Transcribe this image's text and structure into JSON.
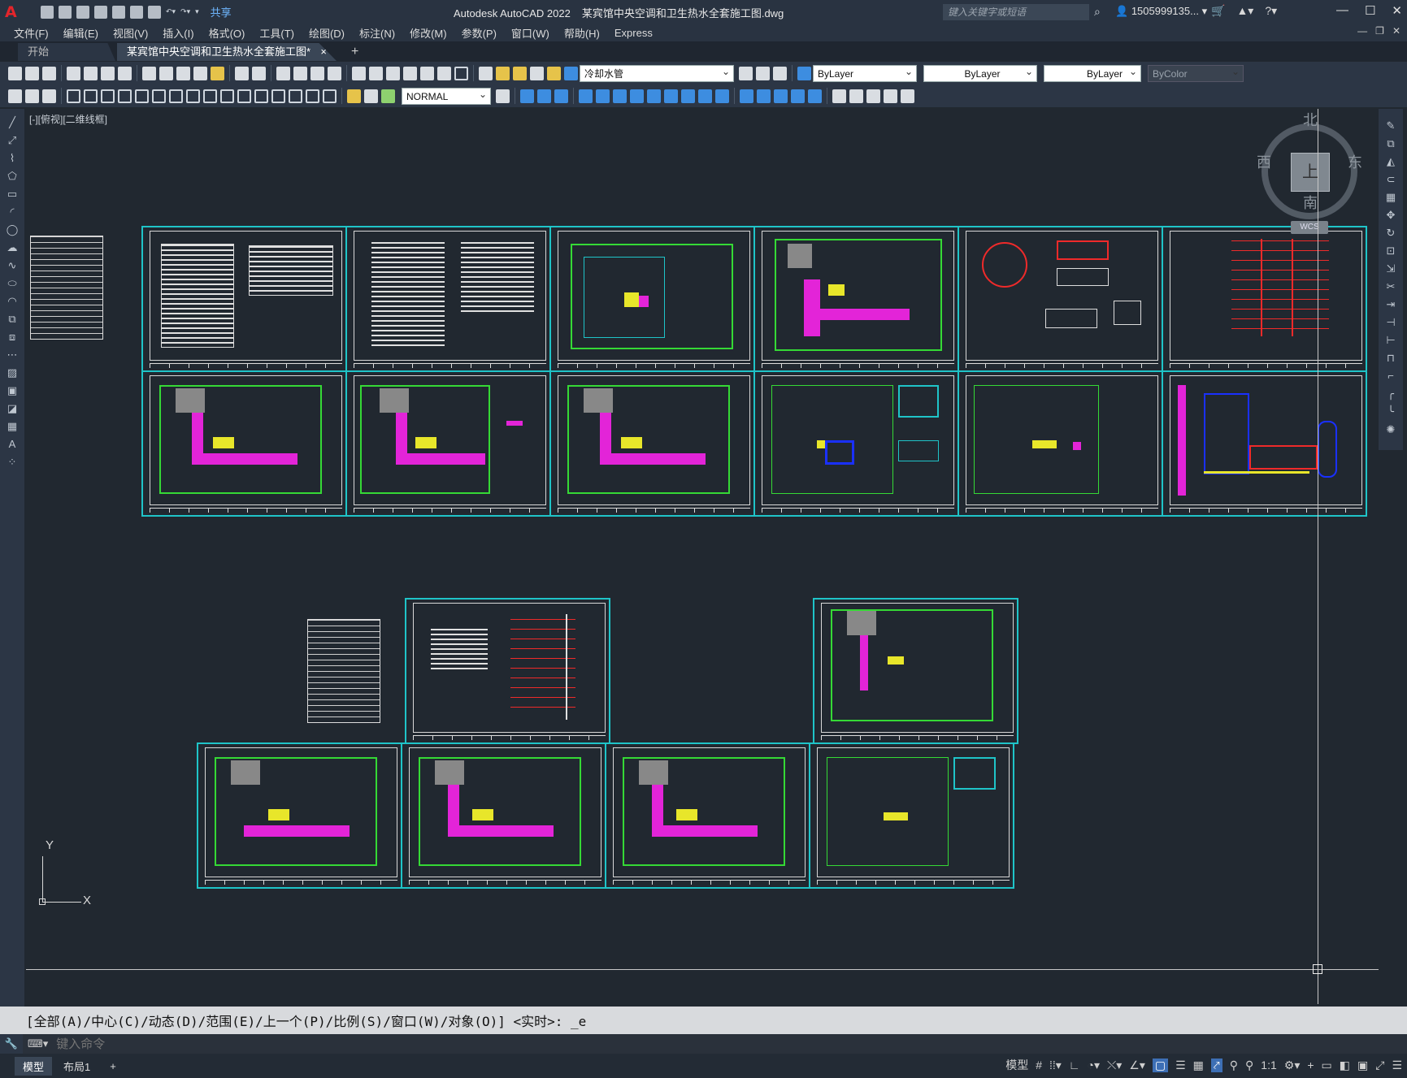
{
  "app": {
    "product": "Autodesk AutoCAD 2022",
    "filename": "某宾馆中央空调和卫生热水全套施工图.dwg",
    "share_label": "共享",
    "search_placeholder": "键入关键字或短语",
    "user": "1505999135...",
    "logo": "A"
  },
  "menu": [
    "文件(F)",
    "编辑(E)",
    "视图(V)",
    "插入(I)",
    "格式(O)",
    "工具(T)",
    "绘图(D)",
    "标注(N)",
    "修改(M)",
    "参数(P)",
    "窗口(W)",
    "帮助(H)",
    "Express"
  ],
  "tabs": {
    "start": "开始",
    "active": "某宾馆中央空调和卫生热水全套施工图*",
    "close": "×",
    "add": "+"
  },
  "toolbar": {
    "layer": "冷却水管",
    "color": "ByLayer",
    "linetype": "ByLayer",
    "lineweight": "ByLayer",
    "plotstyle": "ByColor",
    "textstyle": "NORMAL"
  },
  "viewport": {
    "label": "[-][俯视][二维线框]",
    "compass": {
      "north": "北",
      "south": "南",
      "east": "东",
      "west": "西",
      "cube": "上",
      "wcs": "WCS"
    },
    "ucs_y": "Y",
    "ucs_x": "X"
  },
  "command": {
    "history": "[全部(A)/中心(C)/动态(D)/范围(E)/上一个(P)/比例(S)/窗口(W)/对象(O)] <实时>: _e",
    "placeholder": "键入命令"
  },
  "status": {
    "model_tab": "模型",
    "layout_tab": "布局1",
    "add": "+",
    "model_label": "模型",
    "scale": "1:1"
  },
  "colors": {
    "frame": "#1fc4c8",
    "wall": "#35d935",
    "duct": "#e324d8",
    "equipment": "#e8e62a",
    "pipe": "#ef2a2a",
    "water": "#1a30ff",
    "bg": "#212830"
  }
}
